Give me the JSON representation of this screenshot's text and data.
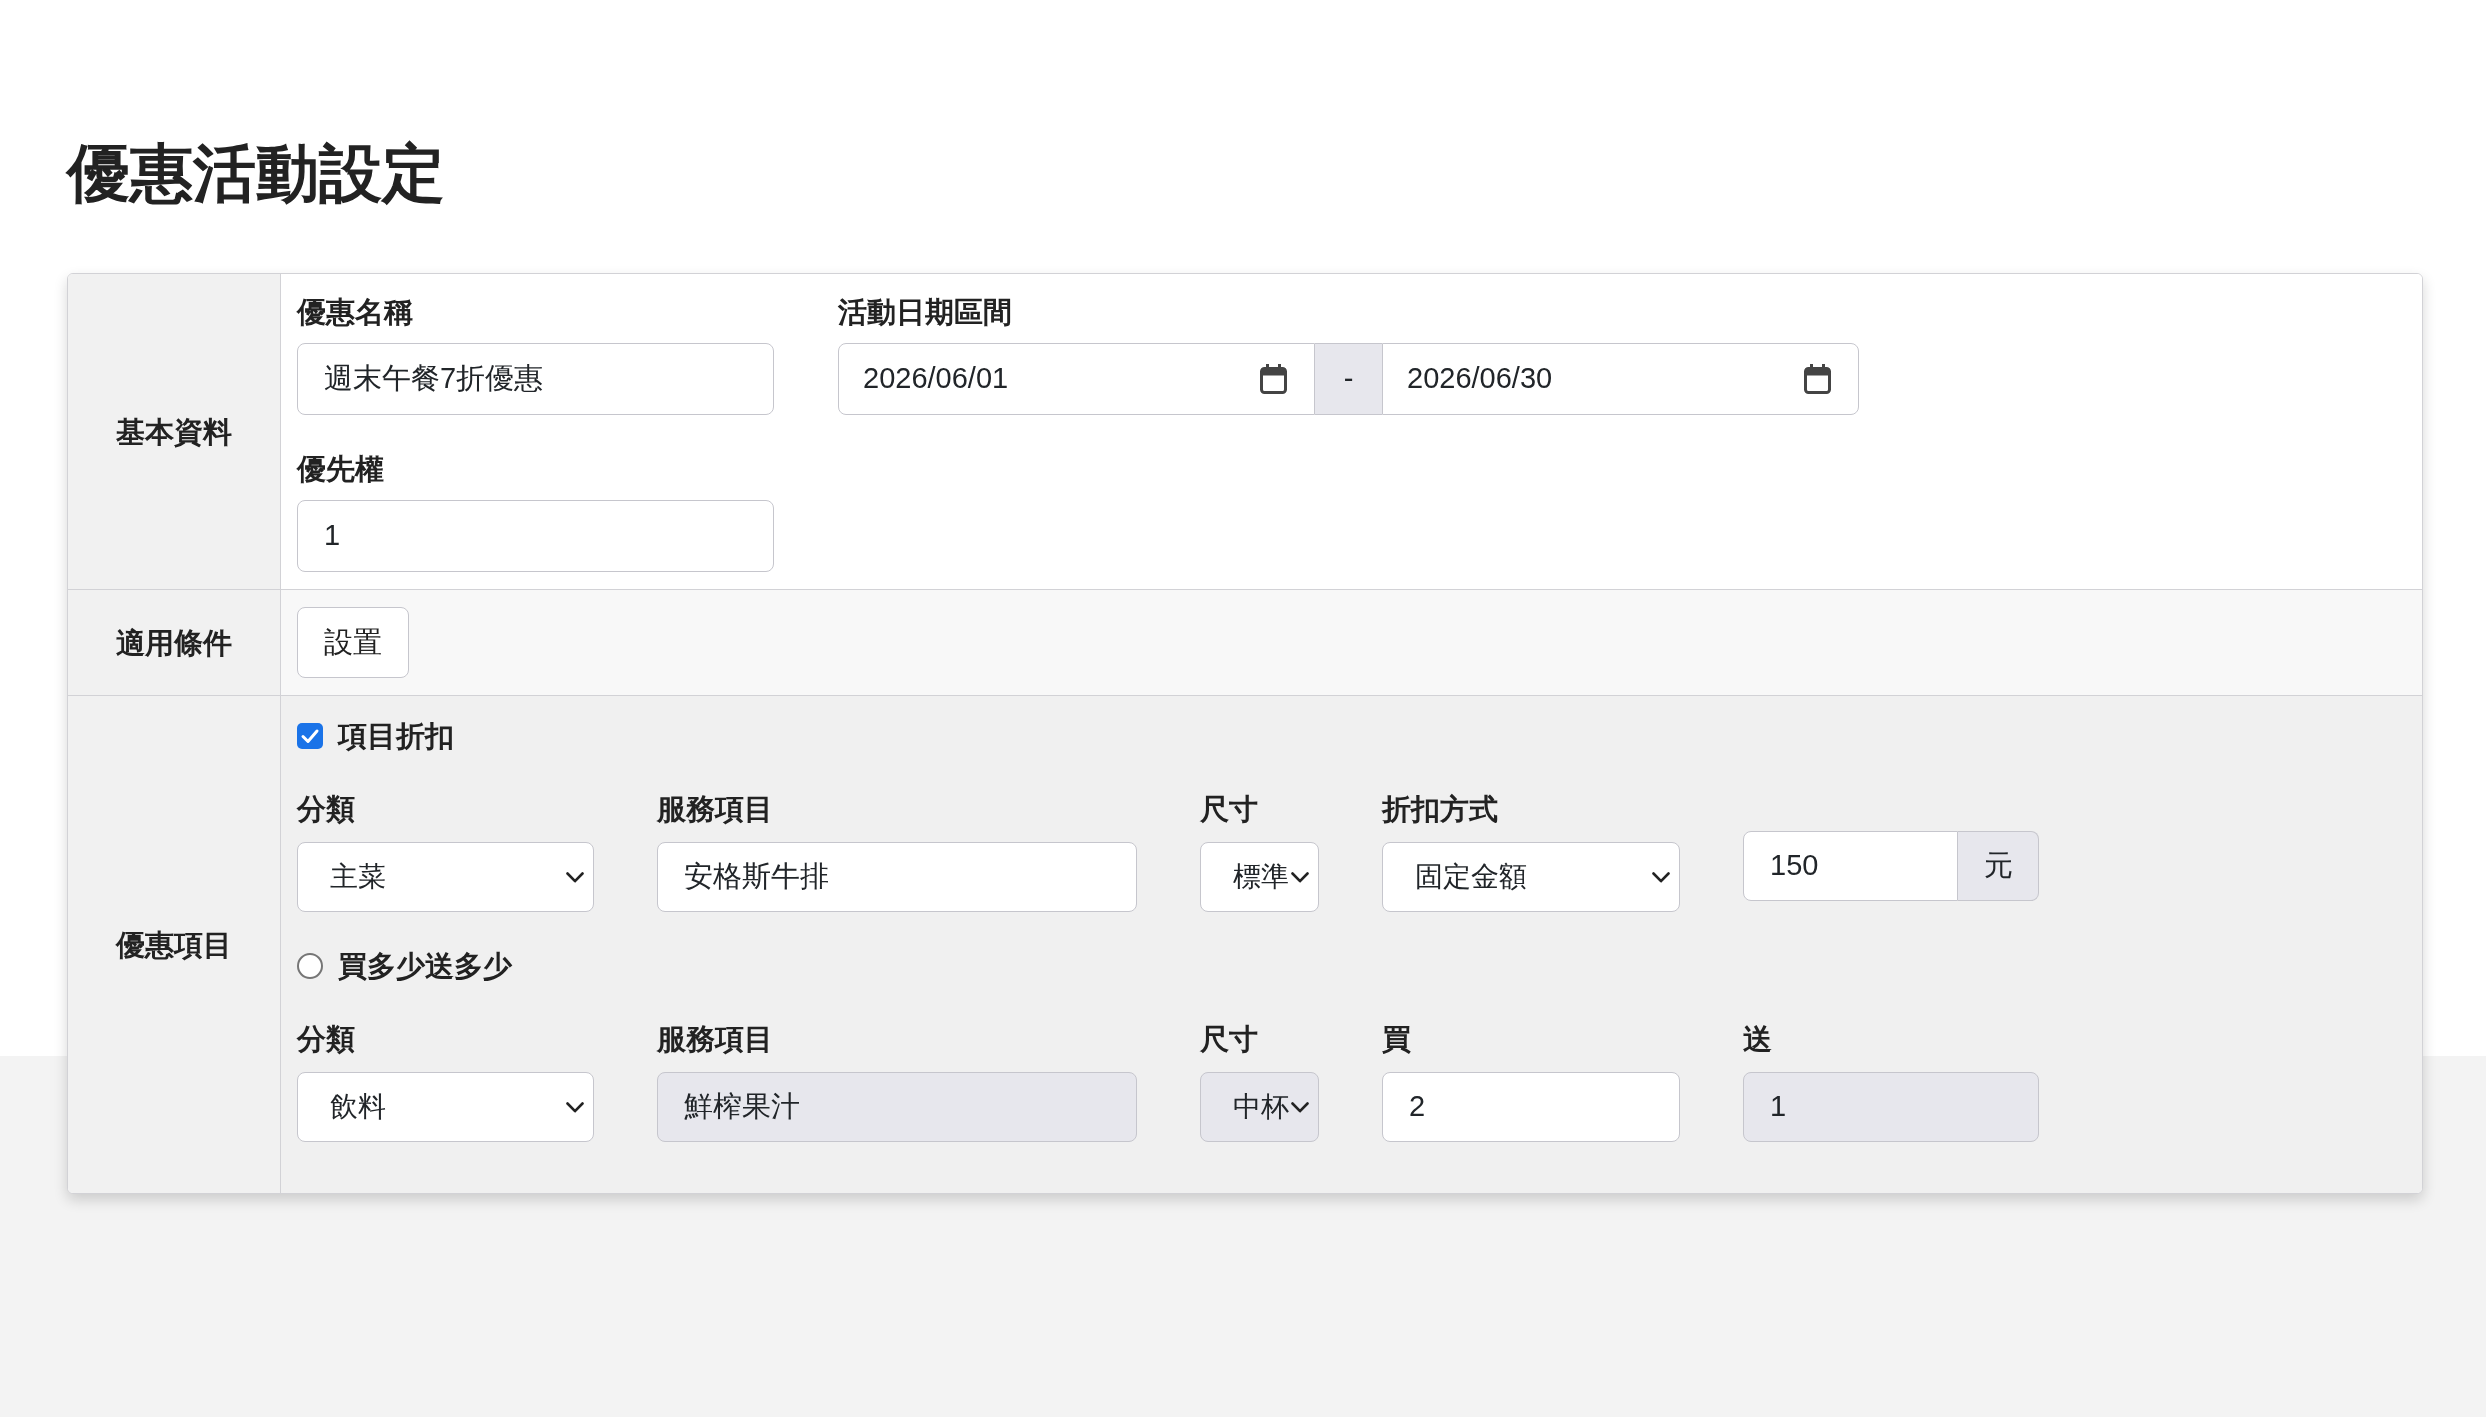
{
  "page_title": "優惠活動設定",
  "basic_info": {
    "label": "基本資料",
    "name": {
      "label": "優惠名稱",
      "value": "週末午餐7折優惠"
    },
    "date_range": {
      "label": "活動日期區間",
      "start": "2026/06/01",
      "separator": "-",
      "end": "2026/06/30"
    },
    "priority": {
      "label": "優先權",
      "value": "1"
    }
  },
  "conditions": {
    "label": "適用條件",
    "button": "設置"
  },
  "discount_items": {
    "label": "優惠項目",
    "options": [
      {
        "kind": "checkbox",
        "checked": true,
        "label": "項目折扣",
        "fields": [
          {
            "kind": "select",
            "label": "分類",
            "value": "主菜",
            "disabled": false
          },
          {
            "kind": "input",
            "label": "服務項目",
            "value": "安格斯牛排",
            "disabled": false
          },
          {
            "kind": "select",
            "label": "尺寸",
            "value": "標準",
            "disabled": false
          },
          {
            "kind": "select",
            "label": "折扣方式",
            "value": "固定金額",
            "disabled": false
          },
          {
            "kind": "addon_input",
            "value": "150",
            "addon": "元",
            "disabled": false
          }
        ]
      },
      {
        "kind": "radio",
        "checked": false,
        "label": "買多少送多少",
        "fields": [
          {
            "kind": "select",
            "label": "分類",
            "value": "飲料",
            "disabled": false
          },
          {
            "kind": "input",
            "label": "服務項目",
            "value": "鮮榨果汁",
            "disabled": true
          },
          {
            "kind": "select",
            "label": "尺寸",
            "value": "中杯",
            "disabled": true
          },
          {
            "kind": "input",
            "label": "買",
            "value": "2",
            "disabled": false
          },
          {
            "kind": "input",
            "label": "送",
            "value": "1",
            "disabled": true
          }
        ]
      }
    ]
  }
}
